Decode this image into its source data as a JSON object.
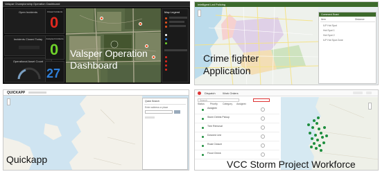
{
  "panels": [
    {
      "caption_line1": "Valsper Operation",
      "caption_line2": "Dashboard",
      "window_title": "Valspar Championship Operation Dashboard",
      "cards": [
        {
          "label": "Open Incidents",
          "value": ""
        },
        {
          "label": "Closed Incidents",
          "value": "0"
        },
        {
          "label": "Assigned Incidents",
          "value": "0"
        },
        {
          "label": "Incidents Closed Today",
          "value": "0"
        },
        {
          "label": "Operational Asset Count",
          "value": "27"
        }
      ],
      "side_title": "Map Legend",
      "colors": {
        "red": "#e0281e",
        "green": "#6fd22a",
        "blue": "#2f7fd9"
      }
    },
    {
      "caption_line1": "Crime fighter",
      "caption_line2": "Application",
      "app_title": "Intelligent Led Policing",
      "side_header": "Command Board",
      "side_cols": [
        "Item",
        "Distance"
      ],
      "side_items": [
        "ILP Hot Spot",
        "Hot Spot 1",
        "Hot Spot 2",
        "ILP Hot Spot Zone",
        "Hot Spot 3"
      ]
    },
    {
      "caption": "Quickapp",
      "logo": "QUICKAPP",
      "widget_title": "Quick Search",
      "widget_label": "Enter address or place"
    },
    {
      "caption": "VCC Storm Project Workforce",
      "tabs": [
        "Dispatch",
        "Work Orders"
      ],
      "filters": [
        "Status",
        "Priority",
        "Category",
        "Assigned"
      ],
      "search_placeholder": "Search",
      "list_items": [
        "Assigned",
        "Storm Debris Pickup",
        "Tree Removal",
        "Downed Line",
        "Road Closure",
        "Flood Check",
        "Debris Pickup"
      ]
    }
  ]
}
